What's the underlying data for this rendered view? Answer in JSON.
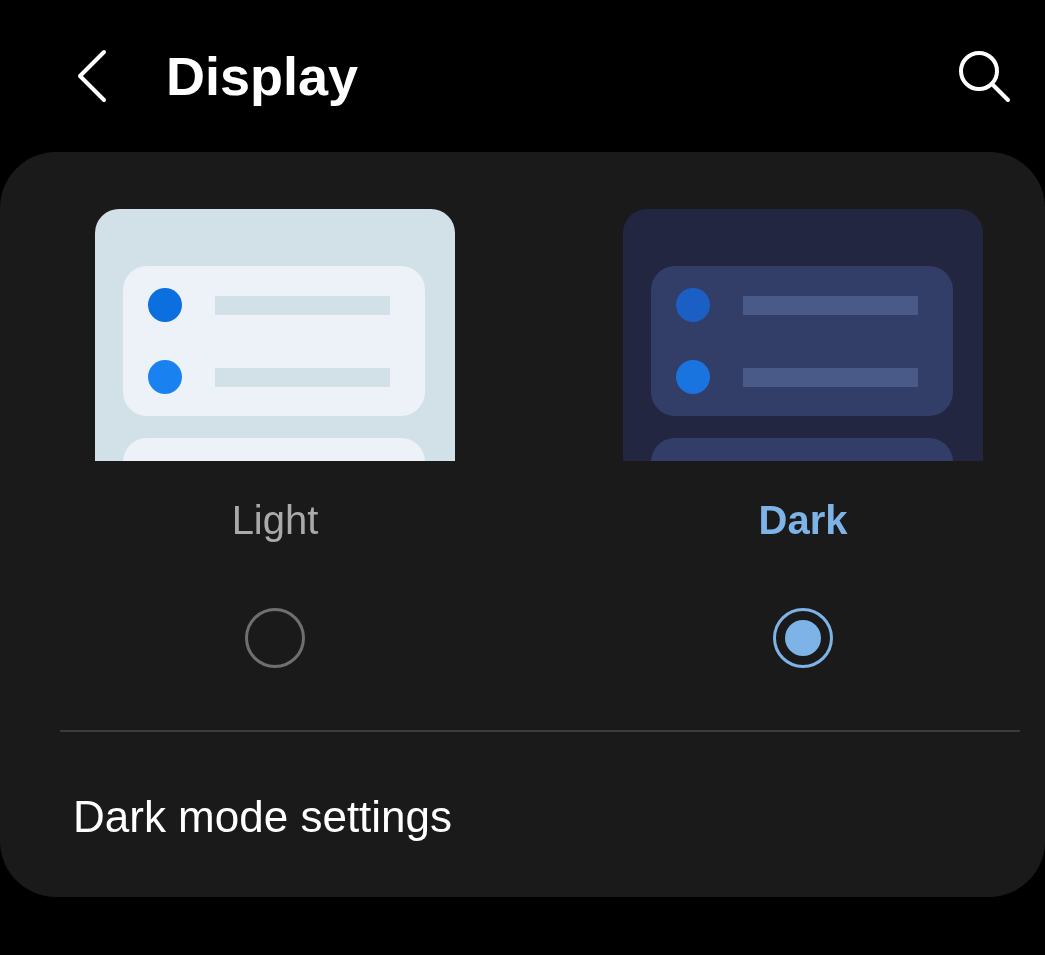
{
  "header": {
    "title": "Display"
  },
  "themes": [
    {
      "label": "Light",
      "kind": "light",
      "selected": false
    },
    {
      "label": "Dark",
      "kind": "dark",
      "selected": true
    }
  ],
  "settings_item": {
    "label": "Dark mode settings"
  }
}
